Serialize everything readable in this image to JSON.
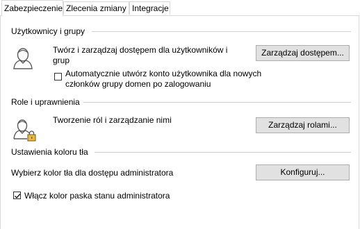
{
  "tabs": [
    {
      "label": "Zabezpieczenie",
      "active": true
    },
    {
      "label": "Zlecenia zmiany",
      "active": false
    },
    {
      "label": "Integracje",
      "active": false
    }
  ],
  "users_section": {
    "title": "Użytkownicy i grupy",
    "icon": "user-icon",
    "description_line1": "Twórz i zarządzaj dostępem dla użytkowników i",
    "description_line2": "grup",
    "button_label": "Zarządzaj dostępem...",
    "auto_create_checkbox": {
      "checked": false,
      "label_line1": "Automatycznie utwórz konto użytkownika dla nowych",
      "label_line2": "członków grupy domen po zalogowaniu"
    }
  },
  "roles_section": {
    "title": "Role i uprawnienia",
    "icon": "user-lock-icon",
    "description": "Tworzenie ról i zarządzanie nimi",
    "button_label": "Zarządzaj rolami..."
  },
  "color_section": {
    "title": "Ustawienia koloru tła",
    "description": "Wybierz kolor tła dla dostępu administratora",
    "button_label": "Konfiguruj...",
    "status_bar_checkbox": {
      "checked": true,
      "label": "Włącz kolor paska stanu administratora"
    }
  }
}
